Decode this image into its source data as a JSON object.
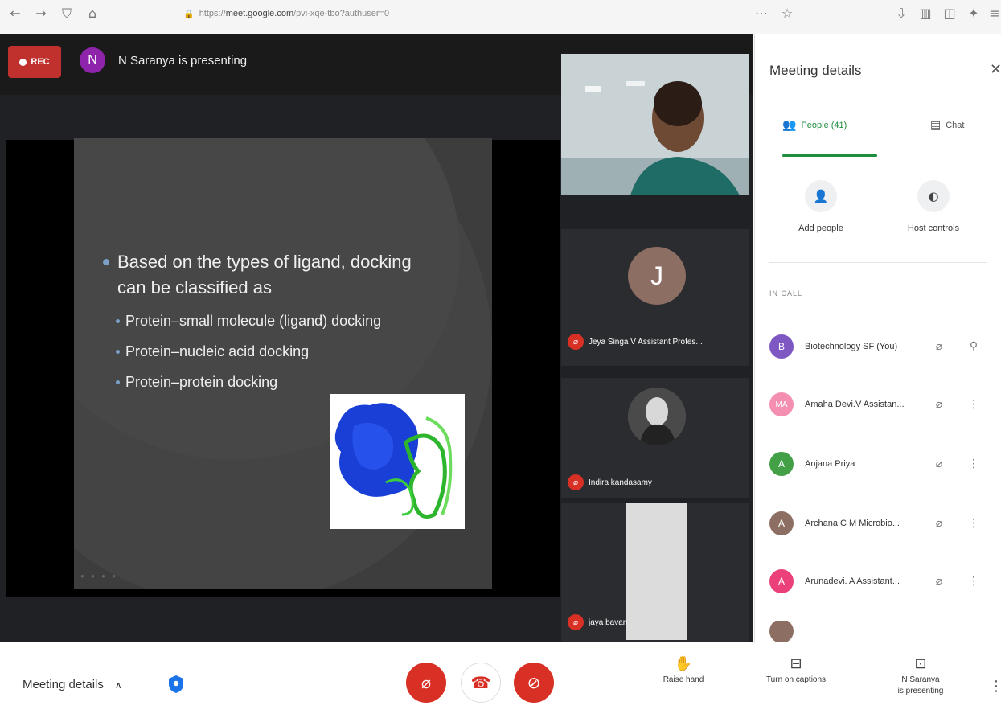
{
  "browser": {
    "url_prefix": "https://",
    "url_host": "meet.google.com",
    "url_path": "/pvi-xqe-tbo?authuser=0"
  },
  "stage": {
    "rec_label": "REC",
    "presenter_initial": "N",
    "presenter_text": "N Saranya is presenting"
  },
  "slide": {
    "main_point": "Based on the types of ligand, docking can be classified as",
    "sub_points": [
      "Protein–small molecule (ligand) docking",
      "Protein–nucleic acid docking",
      "Protein–protein docking"
    ]
  },
  "tiles": [
    {
      "initial": "J",
      "name": "Jeya Singa V Assistant Profes..."
    },
    {
      "name": "Indira kandasamy"
    },
    {
      "name": "jaya bavan"
    }
  ],
  "panel": {
    "title": "Meeting details",
    "close_icon": "close-icon",
    "people_tab": "People (41)",
    "chat_tab": "Chat",
    "add_people": "Add people",
    "host_controls": "Host controls",
    "in_call": "IN CALL",
    "people": [
      {
        "initial": "B",
        "name": "Biotechnology SF (You)",
        "color": "#7e57c2"
      },
      {
        "initial": "MA",
        "name": "Amaha Devi.V Assistan...",
        "color": "#f48fb1"
      },
      {
        "initial": "A",
        "name": "Anjana Priya",
        "color": "#43a047"
      },
      {
        "initial": "A",
        "name": "Archana C M Microbio...",
        "color": "#8d6e63"
      },
      {
        "initial": "A",
        "name": "Arunadevi. A Assistant...",
        "color": "#ec407a"
      }
    ]
  },
  "bottom": {
    "meeting_details": "Meeting details",
    "raise_hand": "Raise hand",
    "captions": "Turn on captions",
    "presenting_line1": "N Saranya",
    "presenting_line2": "is presenting"
  }
}
